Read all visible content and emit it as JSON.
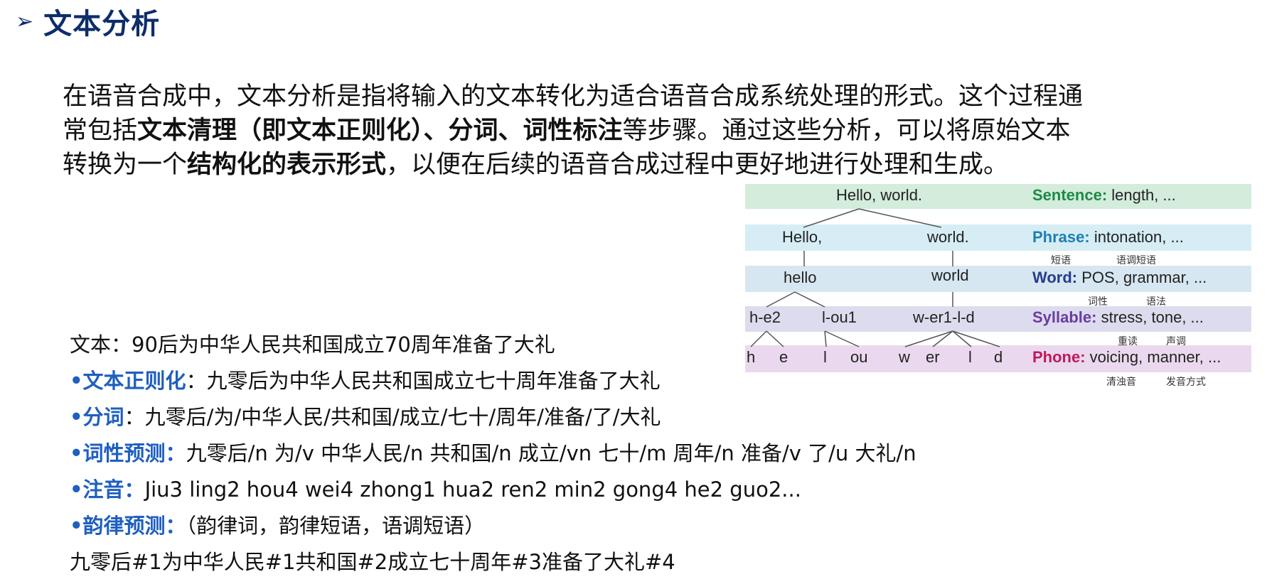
{
  "header": {
    "arrow": "➢",
    "title": "文本分析"
  },
  "intro": {
    "line1": "在语音合成中，文本分析是指将输入的文本转化为适合语音合成系统处理的形式。这个过程通",
    "line2_a": "常包括",
    "line2_b": "文本清理（即文本正则化）、分词、词性标注",
    "line2_c": "等步骤。通过这些分析，可以将原始文本",
    "line3_a": "转换为一个",
    "line3_b": "结构化的表示形式",
    "line3_c": "，以便在后续的语音合成过程中更好地进行处理和生成。"
  },
  "example": {
    "source": "文本：90后为中华人民共和国成立70周年准备了大礼",
    "bullet_mark": "•",
    "normalization_label": "文本正则化",
    "normalization_value": "：九零后为中华人民共和国成立七十周年准备了大礼",
    "segmentation_label": "分词",
    "segmentation_value": "：九零后/为/中华人民/共和国/成立/七十/周年/准备/了/大礼",
    "pos_label": "词性预测：",
    "pos_value": "九零后/n 为/v 中华人民/n 共和国/n 成立/vn 七十/m 周年/n 准备/v 了/u 大礼/n",
    "phonetic_label": "注音：",
    "phonetic_value": "Jiu3 ling2 hou4 wei4 zhong1 hua2 ren2 min2 gong4 he2 guo2...",
    "prosody_label": "韵律预测：",
    "prosody_value": "（韵律词，韵律短语，语调短语）",
    "prosody_output": "九零后#1为中华人民#1共和国#2成立七十周年#3准备了大礼#4"
  },
  "diagram": {
    "colors": {
      "sentence_band": "#d3ecdc",
      "sentence_key": "#1e8a45",
      "phrase_band": "#d6edf5",
      "phrase_key": "#1c7fb0",
      "word_band": "#d6e7f1",
      "word_key": "#283c8c",
      "syllable_band": "#dcdcee",
      "syllable_key": "#6a3ca0",
      "phone_band": "#ead9ee",
      "phone_key": "#c2185b"
    },
    "sentence": {
      "text": "Hello, world.",
      "key": "Sentence:",
      "value": " length, ..."
    },
    "phrase": {
      "left": "Hello,",
      "right": "world.",
      "key": "Phrase:",
      "value": " intonation, ..."
    },
    "phrase_notes": {
      "a": "短语",
      "b": "语调短语"
    },
    "word": {
      "left": "hello",
      "right": "world",
      "key": "Word:",
      "value": " POS, grammar, ..."
    },
    "word_notes": {
      "a": "词性",
      "b": "语法"
    },
    "syllable": {
      "s1": "h-e2",
      "s2": "l-ou1",
      "s3": "w-er1-l-d",
      "key": "Syllable:",
      "value": " stress, tone, ..."
    },
    "syllable_notes": {
      "a": "重读",
      "b": "声调"
    },
    "phone": {
      "p1": "h",
      "p2": "e",
      "p3": "l",
      "p4": "ou",
      "p5": "w",
      "p6": "er",
      "p7": "l",
      "p8": "d",
      "key": "Phone:",
      "value": " voicing, manner, ..."
    },
    "phone_notes": {
      "a": "清浊音",
      "b": "发音方式"
    }
  }
}
